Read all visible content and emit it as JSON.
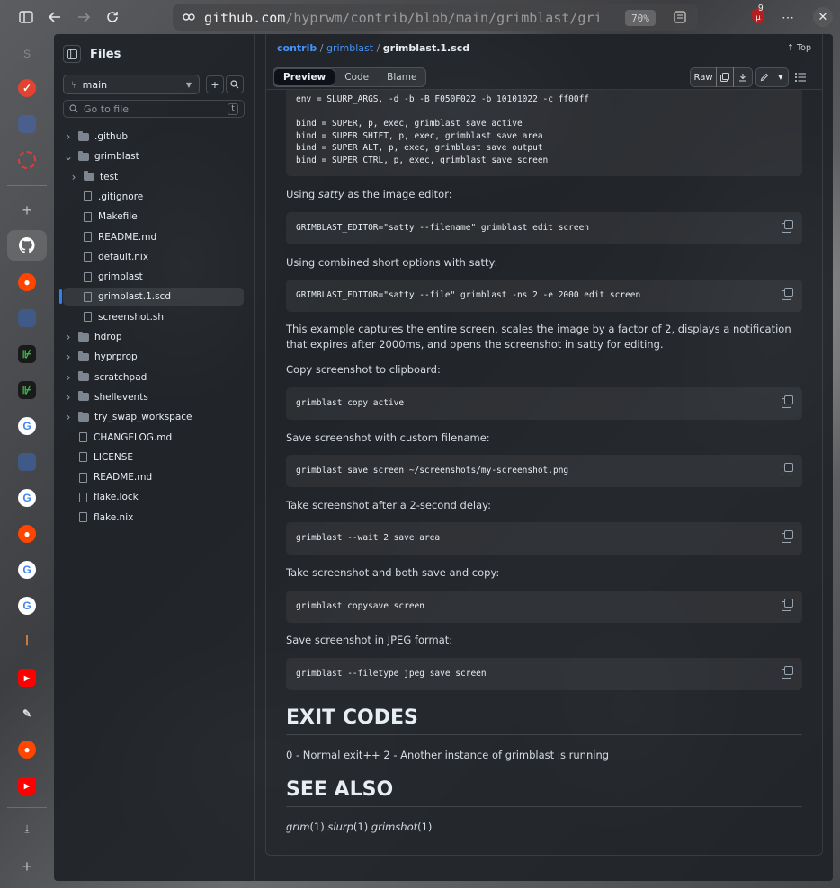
{
  "browser": {
    "url_host": "github.com",
    "url_path": "/hyprwm/contrib/blob/main/grimblast/gri",
    "zoom": "70%",
    "ublock_count": "9"
  },
  "files_panel": {
    "title": "Files",
    "branch": "main",
    "search_placeholder": "Go to file",
    "search_shortcut": "t",
    "tree": [
      {
        "label": ".github",
        "type": "folder",
        "expanded": false,
        "depth": 0
      },
      {
        "label": "grimblast",
        "type": "folder",
        "expanded": true,
        "depth": 0
      },
      {
        "label": "test",
        "type": "folder",
        "expanded": false,
        "depth": 1
      },
      {
        "label": ".gitignore",
        "type": "file",
        "depth": 1
      },
      {
        "label": "Makefile",
        "type": "file",
        "depth": 1
      },
      {
        "label": "README.md",
        "type": "file",
        "depth": 1
      },
      {
        "label": "default.nix",
        "type": "file",
        "depth": 1
      },
      {
        "label": "grimblast",
        "type": "file",
        "depth": 1
      },
      {
        "label": "grimblast.1.scd",
        "type": "file",
        "depth": 1,
        "selected": true
      },
      {
        "label": "screenshot.sh",
        "type": "file",
        "depth": 1
      },
      {
        "label": "hdrop",
        "type": "folder",
        "expanded": false,
        "depth": 0
      },
      {
        "label": "hyprprop",
        "type": "folder",
        "expanded": false,
        "depth": 0
      },
      {
        "label": "scratchpad",
        "type": "folder",
        "expanded": false,
        "depth": 0
      },
      {
        "label": "shellevents",
        "type": "folder",
        "expanded": false,
        "depth": 0
      },
      {
        "label": "try_swap_workspace",
        "type": "folder",
        "expanded": false,
        "depth": 0
      },
      {
        "label": "CHANGELOG.md",
        "type": "file",
        "depth": 0
      },
      {
        "label": "LICENSE",
        "type": "file",
        "depth": 0
      },
      {
        "label": "README.md",
        "type": "file",
        "depth": 0
      },
      {
        "label": "flake.lock",
        "type": "file",
        "depth": 0
      },
      {
        "label": "flake.nix",
        "type": "file",
        "depth": 0
      }
    ]
  },
  "breadcrumb": {
    "root": "contrib",
    "sep": "/",
    "folder": "grimblast",
    "current": "grimblast.1.scd",
    "top_link": "Top"
  },
  "viewer_tabs": [
    "Preview",
    "Code",
    "Blame"
  ],
  "raw_label": "Raw",
  "doc": {
    "top_code": [
      "env = SLURP_ARGS, -d -b -B F050F022 -b 10101022 -c ff00ff",
      "",
      "bind = SUPER, p, exec, grimblast save active",
      "bind = SUPER SHIFT, p, exec, grimblast save area",
      "bind = SUPER ALT, p, exec, grimblast save output",
      "bind = SUPER CTRL, p, exec, grimblast save screen"
    ],
    "p1_prefix": "Using ",
    "p1_em": "satty",
    "p1_suffix": " as the image editor:",
    "c1": "GRIMBLAST_EDITOR=\"satty --filename\" grimblast edit screen",
    "p2": "Using combined short options with satty:",
    "c2": "GRIMBLAST_EDITOR=\"satty --file\" grimblast -ns 2 -e 2000 edit screen",
    "p3": "This example captures the entire screen, scales the image by a factor of 2, displays a notification that expires after 2000ms, and opens the screenshot in satty for editing.",
    "p4": "Copy screenshot to clipboard:",
    "c4": "grimblast copy active",
    "p5": "Save screenshot with custom filename:",
    "c5": "grimblast save screen ~/screenshots/my-screenshot.png",
    "p6": "Take screenshot after a 2-second delay:",
    "c6": "grimblast --wait 2 save area",
    "p7": "Take screenshot and both save and copy:",
    "c7": "grimblast copysave screen",
    "p8": "Save screenshot in JPEG format:",
    "c8": "grimblast --filetype jpeg save screen",
    "h_exit": "EXIT CODES",
    "exit_text": "0 - Normal exit++ 2 - Another instance of grimblast is running",
    "h_see": "SEE ALSO",
    "see_1": "grim",
    "see_1n": "(1) ",
    "see_2": "slurp",
    "see_2n": "(1) ",
    "see_3": "grimshot",
    "see_3n": "(1)"
  },
  "colors": {
    "accent": "#4493f8",
    "selection_bar": "#2f81f7"
  }
}
